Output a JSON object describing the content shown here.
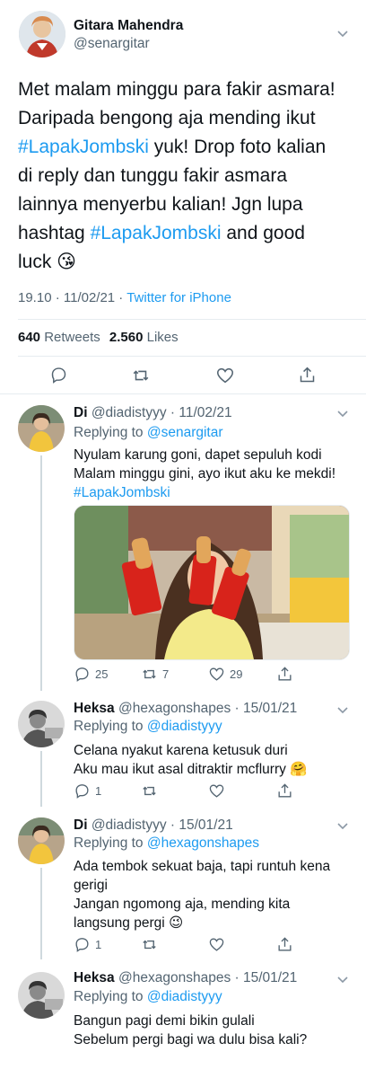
{
  "main_tweet": {
    "name": "Gitara Mahendra",
    "handle": "@senargitar",
    "line1": "Met malam minggu para fakir asmara!",
    "line2": "Daripada bengong aja mending ikut",
    "hashtag1": "#LapakJombski",
    "line3_after": " yuk! Drop foto kalian",
    "line4": "di reply dan tunggu fakir asmara",
    "line5": "lainnya menyerbu kalian! Jgn lupa",
    "line6_before": "hashtag ",
    "hashtag2": "#LapakJombski",
    "line6_after": " and good",
    "line7": "luck 😘",
    "timestamp": "19.10 · 11/02/21 · ",
    "source": "Twitter for iPhone",
    "retweets_count": "640",
    "retweets_label": "Retweets",
    "likes_count": "2.560",
    "likes_label": "Likes"
  },
  "replies": [
    {
      "name": "Di",
      "handle_date": "@diadistyyy · 11/02/21",
      "replying_label": "Replying to ",
      "replying_to": "@senargitar",
      "lines": [
        "Nyulam karung goni, dapet sepuluh kodi",
        "Malam minggu gini, ayo ikut aku ke mekdi!"
      ],
      "hashtag": "#LapakJombski",
      "reply_count": "25",
      "retweet_count": "7",
      "like_count": "29"
    },
    {
      "name": "Heksa",
      "handle_date": "@hexagonshapes · 15/01/21",
      "replying_label": "Replying to ",
      "replying_to": "@diadistyyy",
      "lines": [
        "Celana nyakut karena ketusuk duri",
        "Aku mau ikut asal ditraktir mcflurry 🤗"
      ],
      "reply_count": "1",
      "retweet_count": "",
      "like_count": ""
    },
    {
      "name": "Di",
      "handle_date": "@diadistyyy · 15/01/21",
      "replying_label": "Replying to ",
      "replying_to": "@hexagonshapes",
      "lines": [
        "Ada tembok sekuat baja, tapi runtuh kena",
        "gerigi",
        "Jangan ngomong aja, mending kita",
        "langsung pergi 😉"
      ],
      "reply_count": "1",
      "retweet_count": "",
      "like_count": ""
    },
    {
      "name": "Heksa",
      "handle_date": "@hexagonshapes · 15/01/21",
      "replying_label": "Replying to ",
      "replying_to": "@diadistyyy",
      "lines": [
        "Bangun pagi demi bikin gulali",
        "Sebelum pergi bagi wa dulu bisa kali?"
      ]
    }
  ],
  "icons": {
    "reply": "reply-icon",
    "retweet": "retweet-icon",
    "like": "heart-icon",
    "share": "share-icon",
    "more": "chevron-down-icon"
  },
  "colors": {
    "link": "#1d9bf0",
    "muted": "#536471",
    "divider": "#e6ecf0",
    "text": "#0f1419"
  }
}
